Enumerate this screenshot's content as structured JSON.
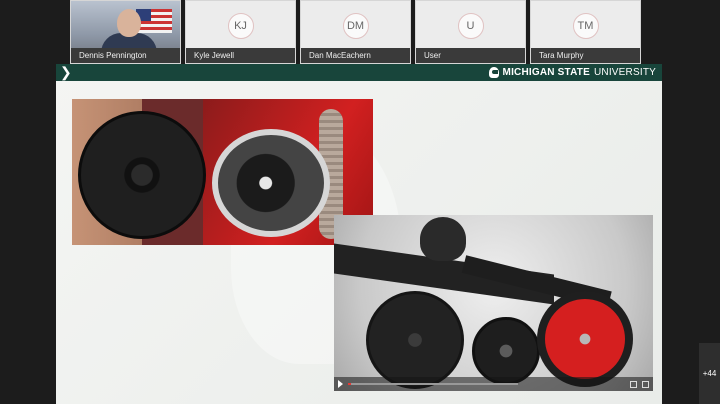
{
  "participants": [
    {
      "name": "Dennis Pennington",
      "initials": "",
      "video": true
    },
    {
      "name": "Kyle Jewell",
      "initials": "KJ",
      "video": false
    },
    {
      "name": "Dan MacEachern",
      "initials": "DM",
      "video": false
    },
    {
      "name": "User",
      "initials": "U",
      "video": false
    },
    {
      "name": "Tara Murphy",
      "initials": "TM",
      "video": false
    }
  ],
  "overflow_count": "+44",
  "slide": {
    "brand_bold": "MICHIGAN STATE",
    "brand_regular": "UNIVERSITY",
    "colors": {
      "header": "#18453b",
      "background": "#eef0ee"
    },
    "photos": [
      {
        "subject": "seed meter disc and housing"
      },
      {
        "subject": "planter row unit with red closing wheel",
        "video_progress": 0.02
      }
    ]
  },
  "icons": {
    "slide_nav": "chevron-right-icon",
    "brand": "spartan-helmet-icon",
    "video_play": "play-icon"
  }
}
